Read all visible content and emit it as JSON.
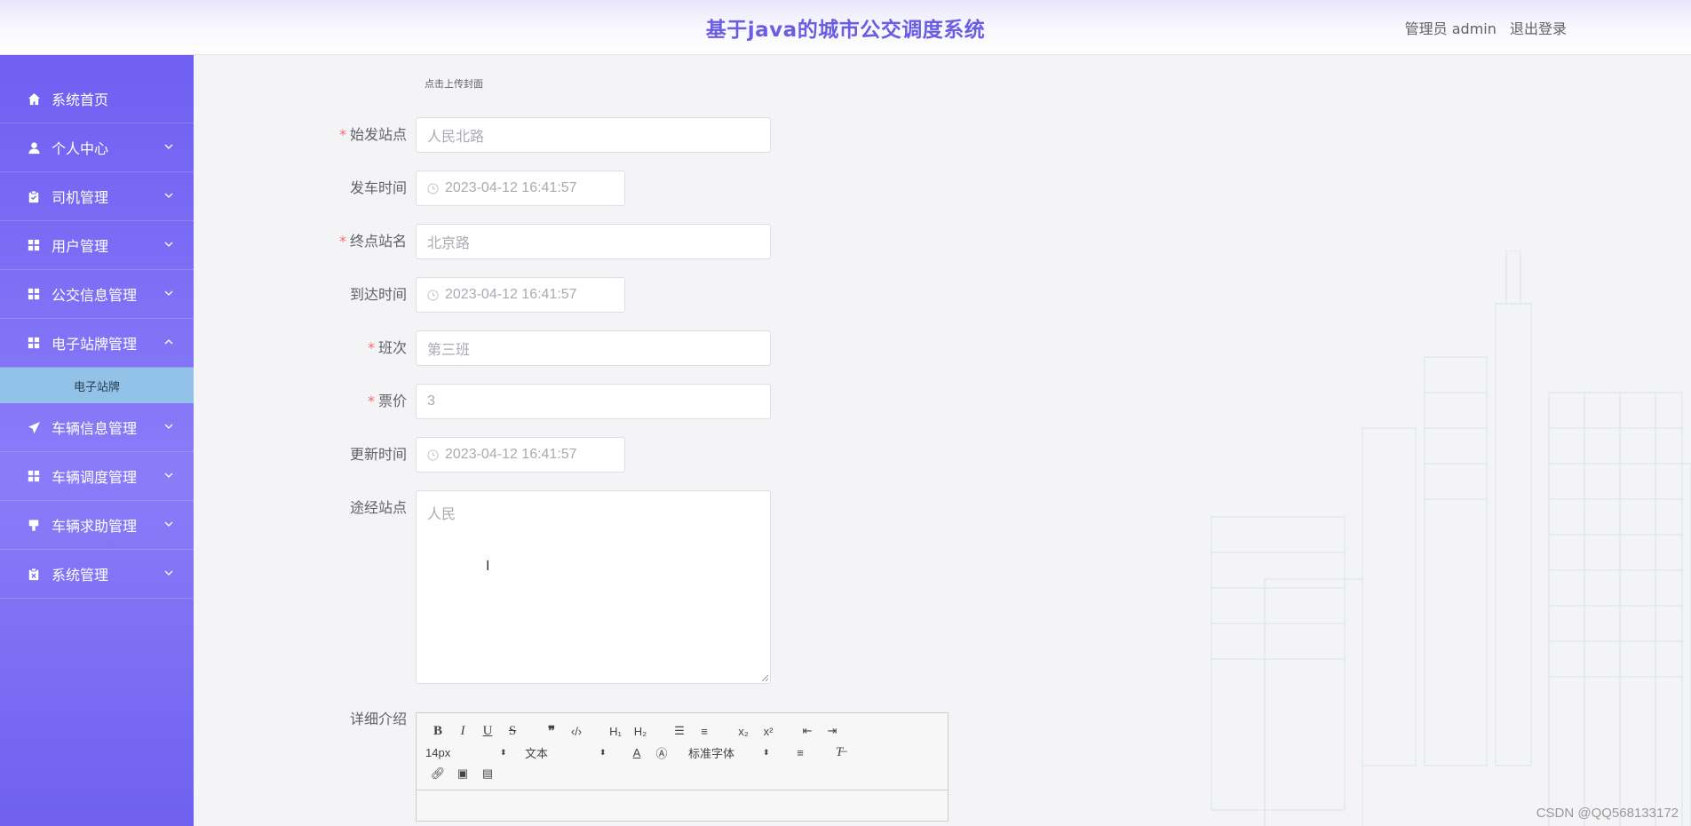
{
  "header": {
    "title": "基于java的城市公交调度系统",
    "user_label": "管理员 admin",
    "logout_label": "退出登录"
  },
  "sidebar": {
    "items": [
      {
        "label": "系统首页",
        "icon": "home-icon"
      },
      {
        "label": "个人中心",
        "icon": "user-icon"
      },
      {
        "label": "司机管理",
        "icon": "clipboard-icon"
      },
      {
        "label": "用户管理",
        "icon": "grid-icon"
      },
      {
        "label": "公交信息管理",
        "icon": "grid-icon"
      },
      {
        "label": "电子站牌管理",
        "icon": "grid-icon",
        "expanded": true
      },
      {
        "label": "车辆信息管理",
        "icon": "send-icon"
      },
      {
        "label": "车辆调度管理",
        "icon": "grid-icon"
      },
      {
        "label": "车辆求助管理",
        "icon": "marker-icon"
      },
      {
        "label": "系统管理",
        "icon": "clipboard-x-icon"
      }
    ],
    "submenu": {
      "label": "电子站牌"
    }
  },
  "form": {
    "upload_hint": "点击上传封面",
    "start_station": {
      "label": "始发站点",
      "required": true,
      "placeholder": "人民北路"
    },
    "depart_time": {
      "label": "发车时间",
      "placeholder": "2023-04-12 16:41:57"
    },
    "end_station": {
      "label": "终点站名",
      "required": true,
      "placeholder": "北京路"
    },
    "arrive_time": {
      "label": "到达时间",
      "placeholder": "2023-04-12 16:41:57"
    },
    "shift": {
      "label": "班次",
      "required": true,
      "placeholder": "第三班"
    },
    "fare": {
      "label": "票价",
      "required": true,
      "placeholder": "3"
    },
    "update_time": {
      "label": "更新时间",
      "placeholder": "2023-04-12 16:41:57"
    },
    "via_stations": {
      "label": "途经站点",
      "placeholder": "人民"
    },
    "details": {
      "label": "详细介绍",
      "size_picker": "14px",
      "header_picker": "文本",
      "font_picker": "标准字体"
    }
  },
  "watermark": "CSDN @QQ568133172",
  "colors": {
    "accent": "#6b5ce4",
    "sidebar": "#7566f4",
    "submenu": "#93c2e8",
    "required": "#f56c6c"
  }
}
